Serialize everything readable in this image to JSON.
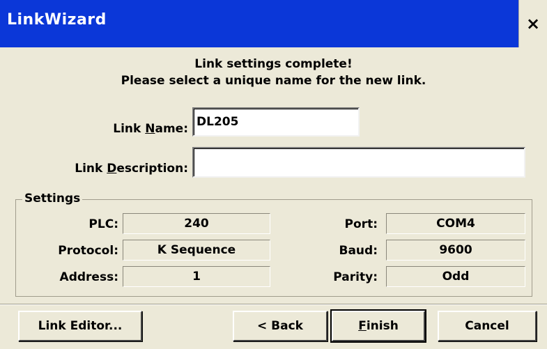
{
  "window": {
    "title": "LinkWizard",
    "close_label": "×"
  },
  "message": {
    "line1": "Link settings complete!",
    "line2": "Please select a unique name for the new link."
  },
  "form": {
    "link_name": {
      "label_pre": "Link ",
      "label_accel": "N",
      "label_post": "ame:",
      "value": "DL205"
    },
    "link_description": {
      "label_pre": "Link ",
      "label_accel": "D",
      "label_post": "escription:",
      "value": ""
    }
  },
  "settings": {
    "title": "Settings",
    "plc": {
      "label": "PLC:",
      "value": "240"
    },
    "protocol": {
      "label": "Protocol:",
      "value": "K Sequence"
    },
    "address": {
      "label": "Address:",
      "value": "1"
    },
    "port": {
      "label": "Port:",
      "value": "COM4"
    },
    "baud": {
      "label": "Baud:",
      "value": "9600"
    },
    "parity": {
      "label": "Parity:",
      "value": "Odd"
    }
  },
  "buttons": {
    "link_editor": "Link Editor...",
    "back": "< Back",
    "finish_accel": "F",
    "finish_rest": "inish",
    "cancel": "Cancel"
  }
}
